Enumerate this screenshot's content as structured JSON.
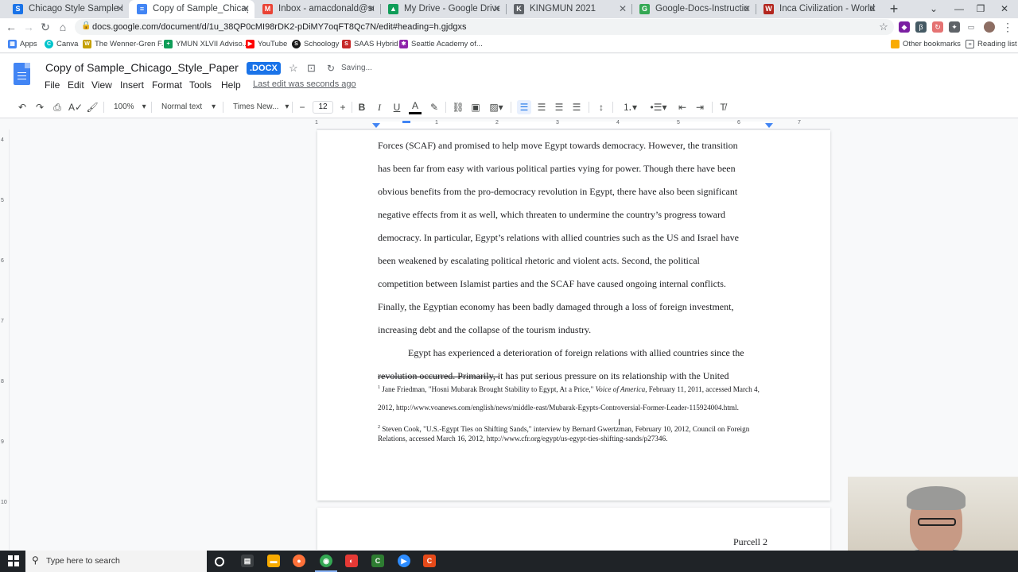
{
  "browser": {
    "tabs": [
      {
        "label": "Chicago Style Sample Paper | Sc",
        "icon": "schoology-icon",
        "color": "#1a73e8",
        "glyph": "S"
      },
      {
        "label": "Copy of Sample_Chicago_Style_",
        "icon": "docs-icon",
        "color": "#4285f4",
        "glyph": "≡"
      },
      {
        "label": "Inbox - amacdonald@seattleaca",
        "icon": "gmail-icon",
        "color": "#ea4335",
        "glyph": "M"
      },
      {
        "label": "My Drive - Google Drive",
        "icon": "drive-icon",
        "color": "#0f9d58",
        "glyph": "▲"
      },
      {
        "label": "KINGMUN 2021",
        "icon": "kingmun-icon",
        "color": "#5f6368",
        "glyph": "K"
      },
      {
        "label": "Google-Docs-Instructions-for-F",
        "icon": "web-icon",
        "color": "#34a853",
        "glyph": "G"
      },
      {
        "label": "Inca Civilization - World History",
        "icon": "worldhistory-icon",
        "color": "#b3261e",
        "glyph": "W"
      }
    ],
    "url": "docs.google.com/document/d/1u_38QP0cMI98rDK2-pDiMY7oqFT8Qc7N/edit#heading=h.gjdgxs"
  },
  "bookmarks": {
    "apps": "Apps",
    "items": [
      {
        "label": "Canva",
        "color": "#00c4cc",
        "glyph": "C"
      },
      {
        "label": "The Wenner-Gren F...",
        "color": "#c5a000",
        "glyph": "W"
      },
      {
        "label": "YMUN XLVII Adviso...",
        "color": "#0f9d58",
        "glyph": "+"
      },
      {
        "label": "YouTube",
        "color": "#ff0000",
        "glyph": "▶"
      },
      {
        "label": "Schoology",
        "color": "#1a1a1a",
        "glyph": "S"
      },
      {
        "label": "SAAS Hybrid",
        "color": "#c62828",
        "glyph": "S"
      },
      {
        "label": "Seattle Academy of...",
        "color": "#8e24aa",
        "glyph": "✱"
      }
    ],
    "other": "Other bookmarks",
    "reading_list": "Reading list"
  },
  "docs": {
    "title": "Copy of Sample_Chicago_Style_Paper",
    "badge": ".DOCX",
    "saving": "Saving...",
    "menus": [
      "File",
      "Edit",
      "View",
      "Insert",
      "Format",
      "Tools",
      "Help"
    ],
    "last_edit": "Last edit was seconds ago",
    "toolbar": {
      "zoom": "100%",
      "style": "Normal text",
      "font": "Times New...",
      "size": "12"
    }
  },
  "ruler": {
    "h_numbers": [
      "1",
      "1",
      "2",
      "3",
      "4",
      "5",
      "6",
      "7"
    ],
    "v_numbers": [
      "4",
      "5",
      "6",
      "7",
      "8",
      "9",
      "10"
    ]
  },
  "page1": {
    "lines": [
      "Forces (SCAF) and promised to help move Egypt towards democracy.  However, the transition",
      "has been far from easy with various political parties vying for power.  Though there have been",
      "obvious benefits from the pro-democracy revolution in Egypt, there have also been significant",
      "negative effects from it as well, which threaten to undermine the country’s progress toward",
      "democracy.  In particular, Egypt’s relations with allied countries such as the US and Israel have",
      "been weakened by escalating political rhetoric and violent acts.  Second, the political",
      "competition between Islamist parties and the SCAF have caused ongoing internal conflicts.",
      "Finally, the Egyptian economy has been badly damaged through a loss of foreign investment,",
      "increasing debt and the collapse of the tourism industry.",
      "Egypt has experienced a deterioration of foreign relations with allied countries since the",
      "revolution occurred.  Primarily, it has put serious pressure on its relationship with the United"
    ],
    "footnotes": {
      "fn1_mark": "1",
      "fn1_a": "Jane Friedman, \"Hosni Mubarak Brought Stability to Egypt, At a Price,\"",
      "fn1_italic": "Voice of America",
      "fn1_b": ", February 11, 2011, accessed March 4,",
      "fn1_c": "2012, http://www.voanews.com/english/news/middle-east/Mubarak-Egypts-Controversial-Former-Leader-115924004.html.",
      "fn2_mark": "2",
      "fn2": "Steven Cook, \"U.S.-Egypt Ties on Shifting Sands,\" interview by Bernard Gwertzman, February 10, 2012, Council on Foreign Relations, accessed March 16, 2012, http://www.cfr.org/egypt/us-egypt-ties-shifting-sands/p27346."
    }
  },
  "page2": {
    "running_head": "Purcell 2"
  },
  "taskbar": {
    "search_placeholder": "Type here to search"
  },
  "colors": {
    "accent": "#1a73e8",
    "docs_blue": "#4285f4"
  }
}
